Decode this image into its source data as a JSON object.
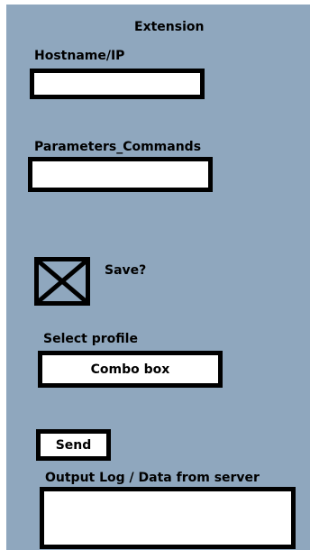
{
  "window": {
    "title": "Extension"
  },
  "fields": {
    "hostname": {
      "label": "Hostname/IP",
      "value": ""
    },
    "parameters": {
      "label": "Parameters_Commands",
      "value": ""
    },
    "save": {
      "label": "Save?",
      "checked": true
    },
    "profile": {
      "label": "Select profile",
      "value": "Combo box"
    }
  },
  "actions": {
    "send_label": "Send"
  },
  "output": {
    "label": "Output Log / Data from server",
    "value": ""
  }
}
